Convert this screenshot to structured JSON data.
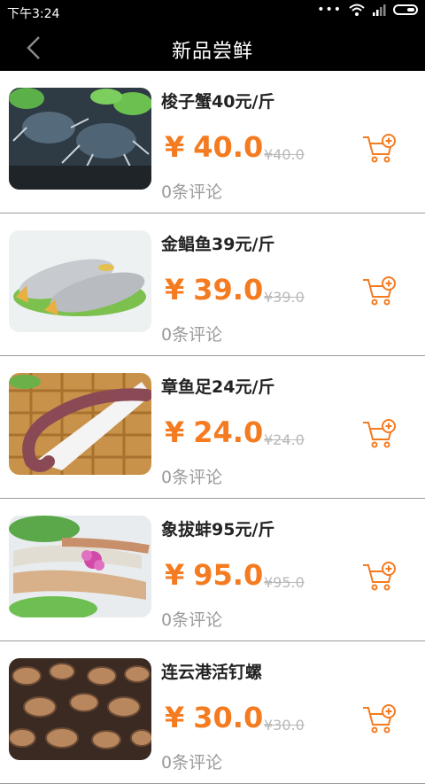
{
  "status": {
    "time": "下午3:24",
    "dots": "•••"
  },
  "header": {
    "title": "新品尝鲜"
  },
  "colors": {
    "accent": "#f47b20",
    "header_bg": "#000000"
  },
  "products": [
    {
      "name": "梭子蟹40元/斤",
      "currency": "¥",
      "price": "40.0",
      "old_price": "¥40.0",
      "reviews": "0条评论",
      "image": "crab"
    },
    {
      "name": "金鲳鱼39元/斤",
      "currency": "¥",
      "price": "39.0",
      "old_price": "¥39.0",
      "reviews": "0条评论",
      "image": "pompano-fish"
    },
    {
      "name": "章鱼足24元/斤",
      "currency": "¥",
      "price": "24.0",
      "old_price": "¥24.0",
      "reviews": "0条评论",
      "image": "octopus-leg"
    },
    {
      "name": "象拔蚌95元/斤",
      "currency": "¥",
      "price": "95.0",
      "old_price": "¥95.0",
      "reviews": "0条评论",
      "image": "geoduck"
    },
    {
      "name": "连云港活钉螺",
      "currency": "¥",
      "price": "30.0",
      "old_price": "¥30.0",
      "reviews": "0条评论",
      "image": "sea-snails"
    }
  ]
}
